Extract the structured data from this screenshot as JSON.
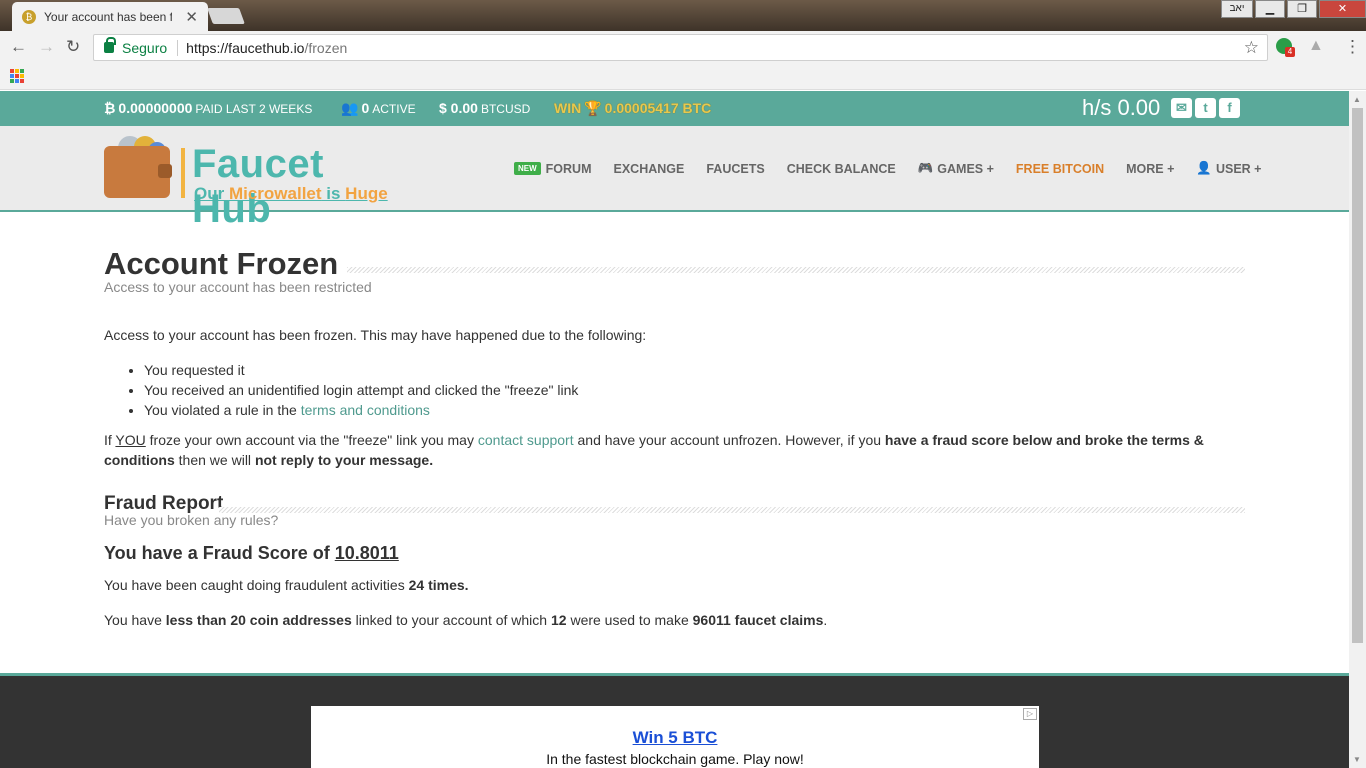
{
  "browser": {
    "tab_title": "Your account has been frozen",
    "tab_favicon": "bitcoin-icon",
    "window_lang": "יאב",
    "omnibox": {
      "secure_label": "Seguro",
      "url_host": "https://faucethub.io",
      "url_path": "/frozen"
    },
    "extension_badge": "4"
  },
  "stats": {
    "paid_value": "0.00000000",
    "paid_label": "PAID LAST 2 WEEKS",
    "active_value": "0",
    "active_label": "ACTIVE",
    "btcusd_value": "$ 0.00",
    "btcusd_label": "BTCUSD",
    "win_label": "WIN",
    "win_value": "0.00005417 BTC",
    "hashrate": "h/s 0.00"
  },
  "header": {
    "logo_name": "Faucet Hub",
    "logo_tag_prefix": "Our ",
    "logo_tag_mid": "Microwallet",
    "logo_tag_mid2": " is ",
    "logo_tag_end": "Huge",
    "nav": {
      "new_badge": "NEW",
      "forum": "FORUM",
      "exchange": "EXCHANGE",
      "faucets": "FAUCETS",
      "check_balance": "CHECK BALANCE",
      "games": "GAMES +",
      "free_bitcoin": "FREE BITCOIN",
      "more": "MORE +",
      "user": "USER +"
    }
  },
  "main": {
    "title": "Account Frozen",
    "subtitle": "Access to your account has been restricted",
    "intro": "Access to your account has been frozen. This may have happened due to the following:",
    "reasons": {
      "r1": "You requested it",
      "r2": "You received an unidentified login attempt and clicked the \"freeze\" link",
      "r3_prefix": "You violated a rule in the ",
      "r3_link": "terms and conditions"
    },
    "notice": {
      "p1": "If ",
      "you": "YOU",
      "p2": " froze your own account via the \"freeze\" link you may ",
      "support_link": "contact support",
      "p3": " and have your account unfrozen. However, if you ",
      "bold1": "have a fraud score below and broke the terms & conditions",
      "p4": " then we will ",
      "bold2": "not reply to your message."
    },
    "fraud": {
      "title": "Fraud Report",
      "subtitle": "Have you broken any rules?",
      "score_label": "You have a Fraud Score of ",
      "score_value": "10.8011",
      "caught_text": "You have been caught doing fraudulent activities ",
      "caught_count": "24 times.",
      "addr_p1": "You have ",
      "addr_bold1": "less than 20 coin addresses",
      "addr_p2": " linked to your account of which ",
      "addr_used": "12",
      "addr_p3": " were used to make ",
      "addr_claims": "96011 faucet claims",
      "addr_end": "."
    }
  },
  "ad": {
    "title": "Win 5 BTC",
    "desc": "In the fastest blockchain game. Play now!"
  }
}
